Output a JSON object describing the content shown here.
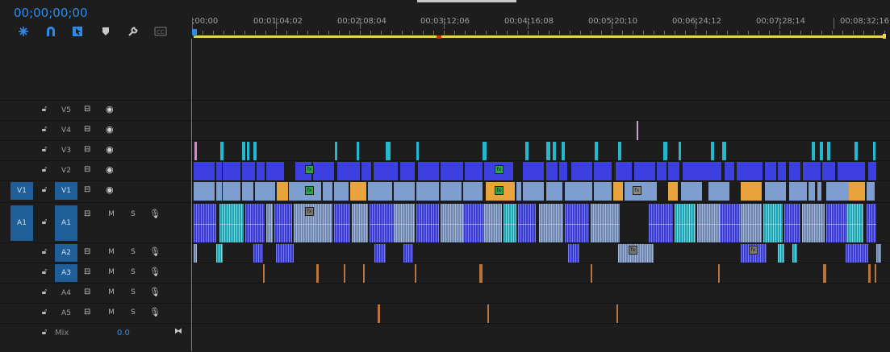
{
  "timecode": "00;00;00;00",
  "toolbar": {
    "icons": [
      "snap-icon",
      "magnet-icon",
      "linked-selection-icon",
      "marker-icon",
      "wrench-icon",
      "captions-icon"
    ]
  },
  "ruler": {
    "labels": [
      ";00;00",
      "00;01;04;02",
      "00;02;08;04",
      "00;03;12;06",
      "00;04;16;08",
      "00;05;20;10",
      "00;06;24;12",
      "00;07;28;14",
      "00;08;32;16"
    ]
  },
  "tracks": {
    "video": [
      {
        "name": "V5",
        "target": false,
        "source": ""
      },
      {
        "name": "V4",
        "target": false,
        "source": ""
      },
      {
        "name": "V3",
        "target": false,
        "source": ""
      },
      {
        "name": "V2",
        "target": false,
        "source": ""
      },
      {
        "name": "V1",
        "target": true,
        "source": "V1"
      }
    ],
    "audio": [
      {
        "name": "A1",
        "target": true,
        "source": "A1"
      },
      {
        "name": "A2",
        "target": true,
        "source": ""
      },
      {
        "name": "A3",
        "target": true,
        "source": ""
      },
      {
        "name": "A4",
        "target": false,
        "source": ""
      },
      {
        "name": "A5",
        "target": false,
        "source": ""
      }
    ],
    "m_label": "M",
    "s_label": "S"
  },
  "mix": {
    "label": "Mix",
    "value": "0.0"
  },
  "colors": {
    "accent": "#2d8ceb",
    "video_clip": "#3d3fe0",
    "video_clip_light": "#7e9ed0",
    "video_clip_orange": "#e8a33c",
    "adjustment_cyan": "#23b8d0",
    "work_area": "#e7d64c",
    "target_fill": "#1e5f99"
  }
}
